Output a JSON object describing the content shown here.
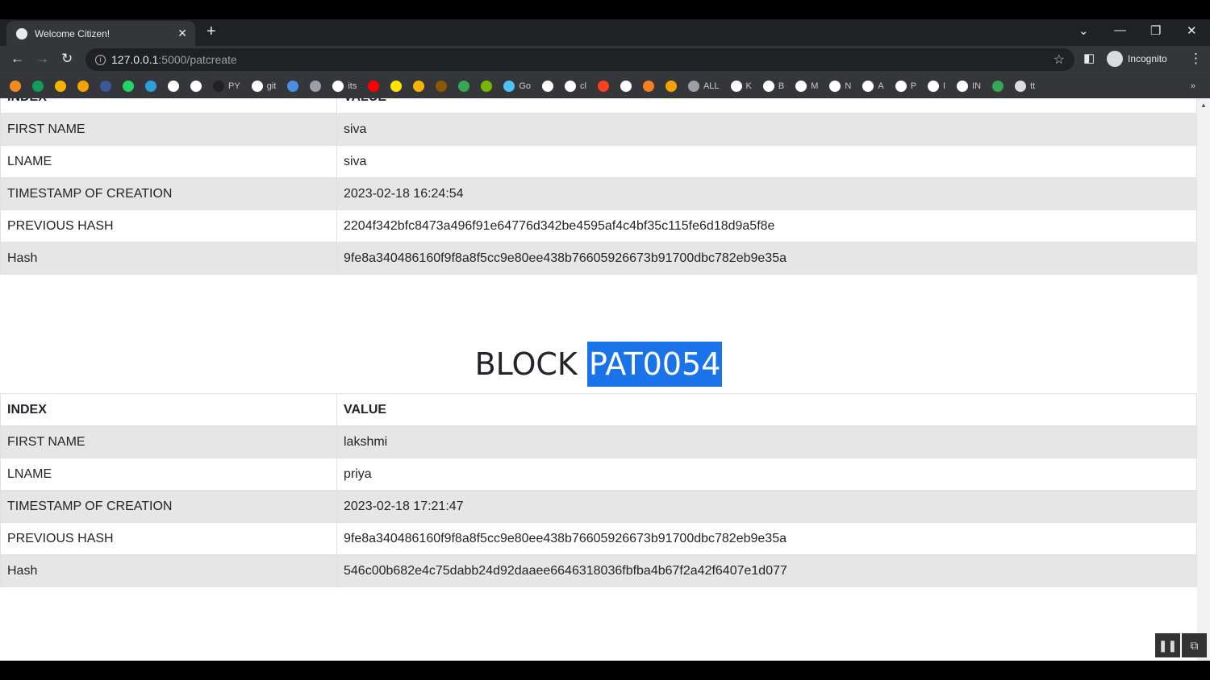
{
  "browser": {
    "tab_title": "Welcome Citizen!",
    "url_host": "127.0.0.1",
    "url_path": ":5000/patcreate",
    "profile": "Incognito",
    "bookmarks": [
      "",
      "",
      "",
      "",
      "",
      "",
      "",
      "",
      "",
      "PY",
      "git",
      "",
      "",
      "its",
      "",
      "",
      "",
      "",
      "",
      "",
      "Go",
      "",
      "cl",
      "",
      "",
      "",
      "",
      "ALL",
      "K",
      "B",
      "M",
      "N",
      "A",
      "P",
      "I",
      "IN",
      "",
      "tt"
    ],
    "bookmark_colors": [
      "#f28b20",
      "#0f9d58",
      "#f4b400",
      "#f4a300",
      "#3b5998",
      "#25d366",
      "#2aa1da",
      "#ffffff",
      "#ffffff",
      "#222222",
      "#ffffff",
      "#4a90e2",
      "#9aa0a6",
      "#ffffff",
      "#ff0000",
      "#ffe400",
      "#f4b400",
      "#8b5a00",
      "#34a853",
      "#76b900",
      "#4fc3f7",
      "#ffffff",
      "#ffffff",
      "#fc3f1d",
      "#ffffff",
      "#f48024",
      "#f4a300",
      "#9aa0a6",
      "#ffffff",
      "#ffffff",
      "#ffffff",
      "#ffffff",
      "#ffffff",
      "#ffffff",
      "#ffffff",
      "#ffffff",
      "#34a853",
      "#dddddd"
    ]
  },
  "block1": {
    "header": [
      "INDEX",
      "VALUE"
    ],
    "rows": [
      [
        "FIRST NAME",
        "siva"
      ],
      [
        "LNAME",
        "siva"
      ],
      [
        "TIMESTAMP OF CREATION",
        "2023-02-18 16:24:54"
      ],
      [
        "PREVIOUS HASH",
        "2204f342bfc8473a496f91e64776d342be4595af4c4bf35c115fe6d18d9a5f8e"
      ],
      [
        "Hash",
        "9fe8a340486160f9f8a8f5cc9e80ee438b76605926673b91700dbc782eb9e35a"
      ]
    ]
  },
  "block2": {
    "label": "BLOCK",
    "id": "PAT0054",
    "header": [
      "INDEX",
      "VALUE"
    ],
    "rows": [
      [
        "FIRST NAME",
        "lakshmi"
      ],
      [
        "LNAME",
        "priya"
      ],
      [
        "TIMESTAMP OF CREATION",
        "2023-02-18 17:21:47"
      ],
      [
        "PREVIOUS HASH",
        "9fe8a340486160f9f8a8f5cc9e80ee438b76605926673b91700dbc782eb9e35a"
      ],
      [
        "Hash",
        "546c00b682e4c75dabb24d92daaee6646318036fbfba4b67f2a42f6407e1d077"
      ]
    ]
  }
}
